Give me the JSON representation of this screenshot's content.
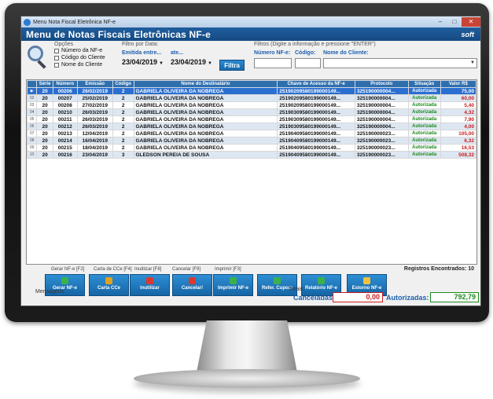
{
  "window": {
    "title": "Menu Nota Fiscal Eletrônica NF-e"
  },
  "banner": {
    "title": "Menu de Notas Fiscais Eletrônicas NF-e",
    "logo": "soft"
  },
  "filters": {
    "opcoes_label": "Opções",
    "options": [
      "Número da NF-e",
      "Código do Cliente",
      "Nome do Cliente"
    ],
    "filtro_data_label": "Filtro por Data:",
    "emitida_label": "Emitida entre...",
    "ate_label": "ate...",
    "date_from": "23/04/2019",
    "date_to": "23/04/2019",
    "filtra_button": "Filtra",
    "filtros_label": "Filtros (Digite a informação e pressione \"ENTER\")",
    "numero_label": "Número NF-e:",
    "codigo_label": "Código:",
    "nome_label": "Nome do Cliente:"
  },
  "table": {
    "columns": [
      "",
      "Série",
      "Número",
      "Emissão",
      "Código",
      "Nome do Destinatário",
      "Chave de Acesso da NF-e",
      "Protocolo",
      "Situação",
      "Valor R$"
    ],
    "rows": [
      {
        "ind": "▶",
        "serie": "20",
        "numero": "00206",
        "emissao": "26/02/2019",
        "codigo": "2",
        "nome": "GABRIELA OLIVEIRA DA NOBREGA",
        "chave": "25190209580199000149...",
        "protocolo": "325190000004...",
        "situacao": "Autorizada",
        "valor": "75,00"
      },
      {
        "ind": "02",
        "serie": "20",
        "numero": "00207",
        "emissao": "25/02/2019",
        "codigo": "2",
        "nome": "GABRIELA OLIVEIRA DA NOBREGA",
        "chave": "25190209580199000149...",
        "protocolo": "325190000004...",
        "situacao": "Autorizada",
        "valor": "60,00"
      },
      {
        "ind": "03",
        "serie": "20",
        "numero": "00208",
        "emissao": "27/02/2019",
        "codigo": "2",
        "nome": "GABRIELA OLIVEIRA DA NOBREGA",
        "chave": "25190209580199000149...",
        "protocolo": "325190000004...",
        "situacao": "Autorizada",
        "valor": "5,40"
      },
      {
        "ind": "04",
        "serie": "20",
        "numero": "00210",
        "emissao": "26/03/2019",
        "codigo": "2",
        "nome": "GABRIELA OLIVEIRA DA NOBREGA",
        "chave": "25190309580199000149...",
        "protocolo": "325190000004...",
        "situacao": "Autorizada",
        "valor": "4,32"
      },
      {
        "ind": "05",
        "serie": "20",
        "numero": "00211",
        "emissao": "26/03/2019",
        "codigo": "2",
        "nome": "GABRIELA OLIVEIRA DA NOBREGA",
        "chave": "25190309580199000149...",
        "protocolo": "325190000004...",
        "situacao": "Autorizada",
        "valor": "7,90"
      },
      {
        "ind": "06",
        "serie": "20",
        "numero": "00212",
        "emissao": "26/03/2019",
        "codigo": "2",
        "nome": "GABRIELA OLIVEIRA DA NOBREGA",
        "chave": "25190309580199000149...",
        "protocolo": "325190000004...",
        "situacao": "Autorizada",
        "valor": "4,00"
      },
      {
        "ind": "07",
        "serie": "20",
        "numero": "00213",
        "emissao": "12/04/2019",
        "codigo": "2",
        "nome": "GABRIELA OLIVEIRA DA NOBREGA",
        "chave": "25190409580199000149...",
        "protocolo": "325190000023...",
        "situacao": "Autorizada",
        "valor": "105,00"
      },
      {
        "ind": "08",
        "serie": "20",
        "numero": "00214",
        "emissao": "16/04/2019",
        "codigo": "2",
        "nome": "GABRIELA OLIVEIRA DA NOBREGA",
        "chave": "25190409580199000149...",
        "protocolo": "325190000023...",
        "situacao": "Autorizada",
        "valor": "6,32"
      },
      {
        "ind": "09",
        "serie": "20",
        "numero": "00215",
        "emissao": "18/04/2019",
        "codigo": "2",
        "nome": "GABRIELA OLIVEIRA DA NOBREGA",
        "chave": "25190409580199000149...",
        "protocolo": "325190000023...",
        "situacao": "Autorizada",
        "valor": "16,53"
      },
      {
        "ind": "10",
        "serie": "20",
        "numero": "00216",
        "emissao": "23/04/2019",
        "codigo": "3",
        "nome": "GLEDSON PEREIA DE SOUSA",
        "chave": "25190409580199000149...",
        "protocolo": "325190000023...",
        "situacao": "Autorizada",
        "valor": "508,32"
      }
    ]
  },
  "toolbar": {
    "registros": "Registros Encontrados: 10",
    "shortcuts": [
      "Gerar NF-e [F2]",
      "Carta de CCe [F4]",
      "Inutilizar [F8]",
      "Cancelar [F9]",
      "Imprimir [F3]"
    ],
    "buttons": [
      "Gerar NF-e",
      "Carta CCe",
      "Inutilizar",
      "Cancelar!",
      "Imprimir NF-e",
      "Refer. Cupom",
      "Relatório NF-e",
      "Estorno NF-e"
    ],
    "colors": [
      "#3cb14a",
      "#e0a020",
      "#d83a2f",
      "#d83a2f",
      "#3cb14a",
      "#3cb14a",
      "#3cb14a",
      "#f0c040"
    ]
  },
  "status": {
    "mensagens_label": "Mensagens:",
    "totais_label": "Totais:",
    "canceladas_label": "Canceladas:",
    "canceladas_value": "0,00",
    "autorizadas_label": "Autorizadas:",
    "autorizadas_value": "792,79"
  }
}
